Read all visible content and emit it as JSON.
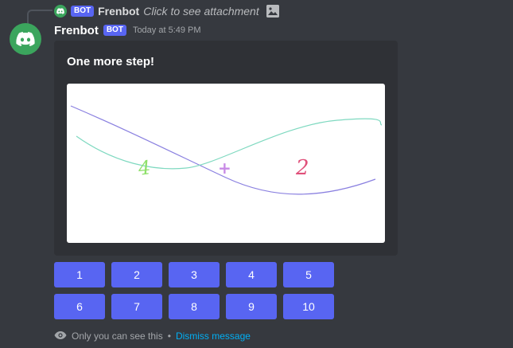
{
  "reply": {
    "bot_badge": "BOT",
    "username": "Frenbot",
    "text": "Click to see attachment"
  },
  "message": {
    "username": "Frenbot",
    "bot_badge": "BOT",
    "timestamp": "Today at 5:49 PM",
    "embed": {
      "title": "One more step!",
      "captcha_glyphs": [
        "4",
        "+",
        "2"
      ]
    }
  },
  "buttons": [
    "1",
    "2",
    "3",
    "4",
    "5",
    "6",
    "7",
    "8",
    "9",
    "10"
  ],
  "footer": {
    "ephemeral_text": "Only you can see this",
    "separator": "•",
    "dismiss_label": "Dismiss message"
  },
  "colors": {
    "background": "#36393f",
    "embed": "#2f3136",
    "blurple": "#5865f2",
    "avatar_green": "#3ba55d",
    "link": "#00aff4"
  }
}
